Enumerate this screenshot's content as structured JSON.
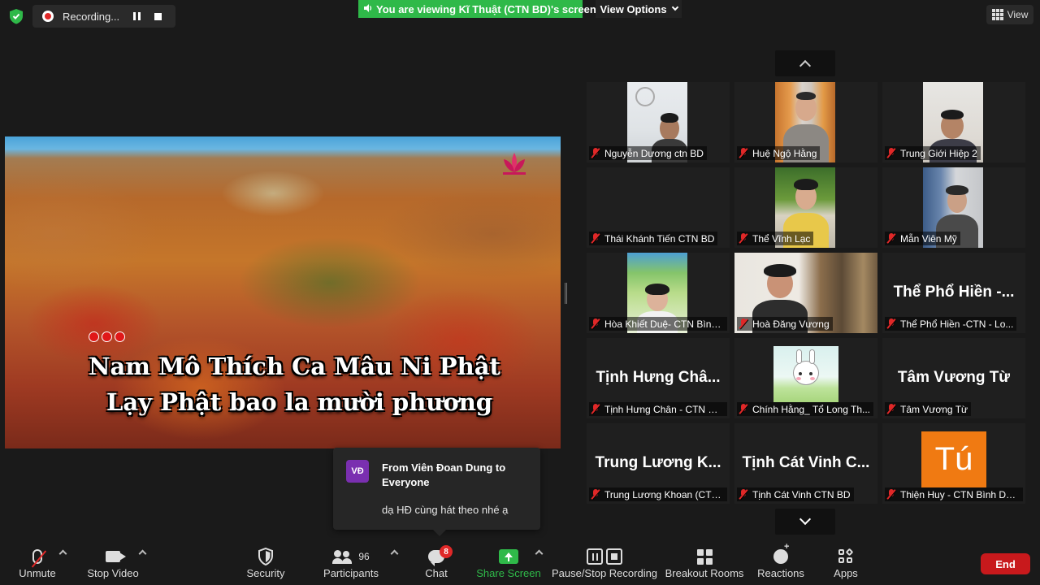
{
  "top_bar": {
    "recording_label": "Recording...",
    "viewing_banner": "You are viewing Kĩ Thuật (CTN BD)'s screen",
    "view_options_label": "View Options",
    "view_label": "View"
  },
  "shared_screen": {
    "lyric_line_1": "Nam Mô Thích Ca Mâu Ni Phật",
    "lyric_line_2": "Lạy Phật bao la mười phương"
  },
  "gallery": {
    "tiles": [
      {
        "name": "Nguyễn Dương ctn BD",
        "display_text": ""
      },
      {
        "name": "Huệ Ngộ Hằng",
        "display_text": ""
      },
      {
        "name": "Trung Giới Hiệp 2",
        "display_text": ""
      },
      {
        "name": "Thái Khánh Tiến CTN BD",
        "display_text": ""
      },
      {
        "name": "Thể Vĩnh Lạc",
        "display_text": ""
      },
      {
        "name": "Mẫn Viên Mỹ",
        "display_text": ""
      },
      {
        "name": "Hòa Khiết Duệ- CTN Bình...",
        "display_text": ""
      },
      {
        "name": "Hoà Đăng Vương",
        "display_text": ""
      },
      {
        "name": "Thể Phổ Hiền  -CTN - Lo...",
        "display_text": "Thể Phổ Hiền  -..."
      },
      {
        "name": "Tịnh Hưng Chân - CTN Bì...",
        "display_text": "Tịnh Hưng Châ..."
      },
      {
        "name": "Chính Hằng_ Tổ Long Th...",
        "display_text": ""
      },
      {
        "name": "Tâm Vương Từ",
        "display_text": "Tâm Vương Từ"
      },
      {
        "name": "Trung Lương Khoan (CTN...",
        "display_text": "Trung Lương K..."
      },
      {
        "name": "Tịnh Cát Vinh CTN BD",
        "display_text": "Tịnh Cát Vinh C..."
      },
      {
        "name": "Thiện Huy - CTN Bình Dư...",
        "display_text": "Tú"
      }
    ]
  },
  "chat_toast": {
    "avatar_initials": "VĐ",
    "from": "From Viên Đoan Dung to Everyone",
    "message": "dạ HĐ cùng hát theo nhé ạ"
  },
  "toolbar": {
    "unmute_label": "Unmute",
    "stop_video_label": "Stop Video",
    "security_label": "Security",
    "participants_label": "Participants",
    "participants_count": "96",
    "chat_label": "Chat",
    "chat_badge": "8",
    "share_screen_label": "Share Screen",
    "pause_stop_recording_label": "Pause/Stop Recording",
    "breakout_rooms_label": "Breakout Rooms",
    "reactions_label": "Reactions",
    "apps_label": "Apps",
    "end_label": "End"
  },
  "colors": {
    "share_green": "#2fb949",
    "end_red": "#c8191c",
    "muted_red": "#e02828",
    "toast_avatar": "#7a2fb0",
    "tu_avatar": "#f07a12"
  }
}
